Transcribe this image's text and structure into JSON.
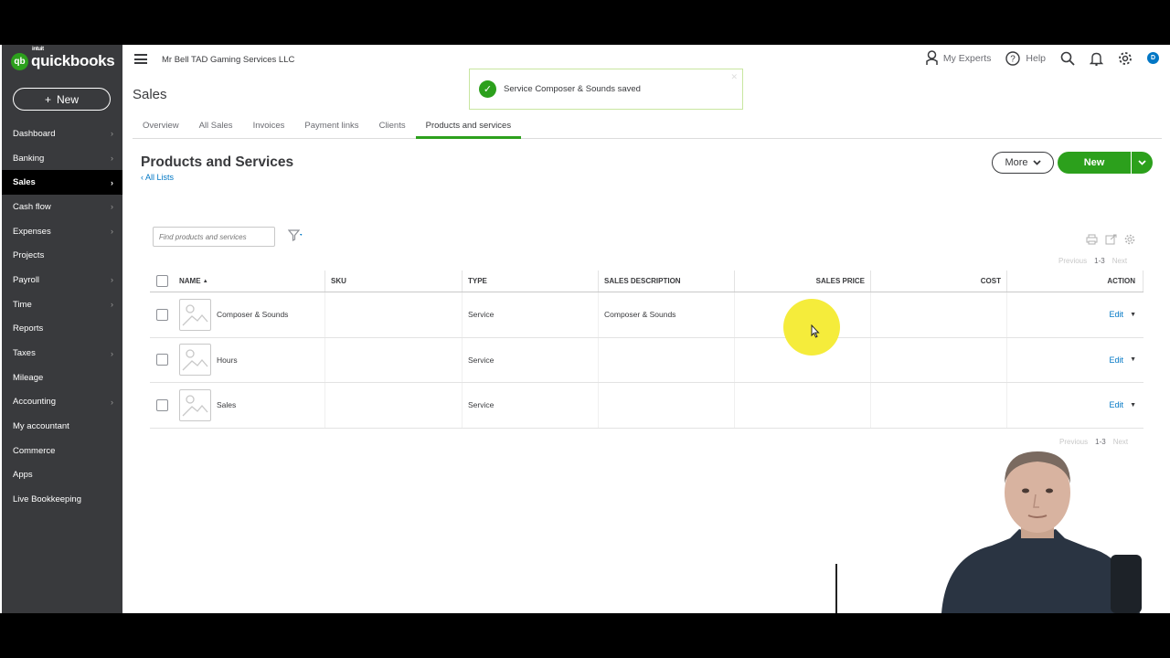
{
  "brand": {
    "intuit": "intuit",
    "name": "quickbooks",
    "mark": "qb"
  },
  "sidebar": {
    "new_label": "New",
    "items": [
      {
        "label": "Dashboard",
        "chevron": true
      },
      {
        "label": "Banking",
        "chevron": true
      },
      {
        "label": "Sales",
        "chevron": true,
        "active": true
      },
      {
        "label": "Cash flow",
        "chevron": true
      },
      {
        "label": "Expenses",
        "chevron": true
      },
      {
        "label": "Projects",
        "chevron": false
      },
      {
        "label": "Payroll",
        "chevron": true
      },
      {
        "label": "Time",
        "chevron": true
      },
      {
        "label": "Reports",
        "chevron": false
      },
      {
        "label": "Taxes",
        "chevron": true
      },
      {
        "label": "Mileage",
        "chevron": false
      },
      {
        "label": "Accounting",
        "chevron": true
      },
      {
        "label": "My accountant",
        "chevron": false
      },
      {
        "label": "Commerce",
        "chevron": false
      },
      {
        "label": "Apps",
        "chevron": false
      },
      {
        "label": "Live Bookkeeping",
        "chevron": false
      }
    ]
  },
  "topbar": {
    "company": "Mr Bell TAD Gaming Services LLC",
    "my_experts": "My Experts",
    "help": "Help",
    "avatar_initial": "D"
  },
  "page": {
    "title": "Sales",
    "tabs": [
      {
        "label": "Overview"
      },
      {
        "label": "All Sales"
      },
      {
        "label": "Invoices"
      },
      {
        "label": "Payment links"
      },
      {
        "label": "Clients"
      },
      {
        "label": "Products and services",
        "active": true
      }
    ]
  },
  "toast": {
    "message": "Service Composer & Sounds saved"
  },
  "products": {
    "title": "Products and Services",
    "all_lists": "All Lists",
    "more_label": "More",
    "new_label": "New",
    "search_placeholder": "Find products and services",
    "pager": {
      "previous": "Previous",
      "range": "1-3",
      "next": "Next"
    },
    "columns": {
      "name": "NAME",
      "sku": "SKU",
      "type": "TYPE",
      "description": "SALES DESCRIPTION",
      "price": "SALES PRICE",
      "cost": "COST",
      "action": "ACTION"
    },
    "rows": [
      {
        "name": "Composer & Sounds",
        "sku": "",
        "type": "Service",
        "description": "Composer & Sounds",
        "price": "",
        "cost": "",
        "action": "Edit"
      },
      {
        "name": "Hours",
        "sku": "",
        "type": "Service",
        "description": "",
        "price": "",
        "cost": "",
        "action": "Edit"
      },
      {
        "name": "Sales",
        "sku": "",
        "type": "Service",
        "description": "",
        "price": "",
        "cost": "",
        "action": "Edit"
      }
    ]
  },
  "icons": {
    "search": "search-icon",
    "bell": "bell-icon",
    "gear": "gear-icon",
    "filter": "filter-icon",
    "print": "print-icon",
    "export": "export-icon"
  },
  "colors": {
    "brand_green": "#2ca01c",
    "sidebar": "#393a3d",
    "link_blue": "#0077c5",
    "cursor_highlight": "#f5ec3b"
  }
}
